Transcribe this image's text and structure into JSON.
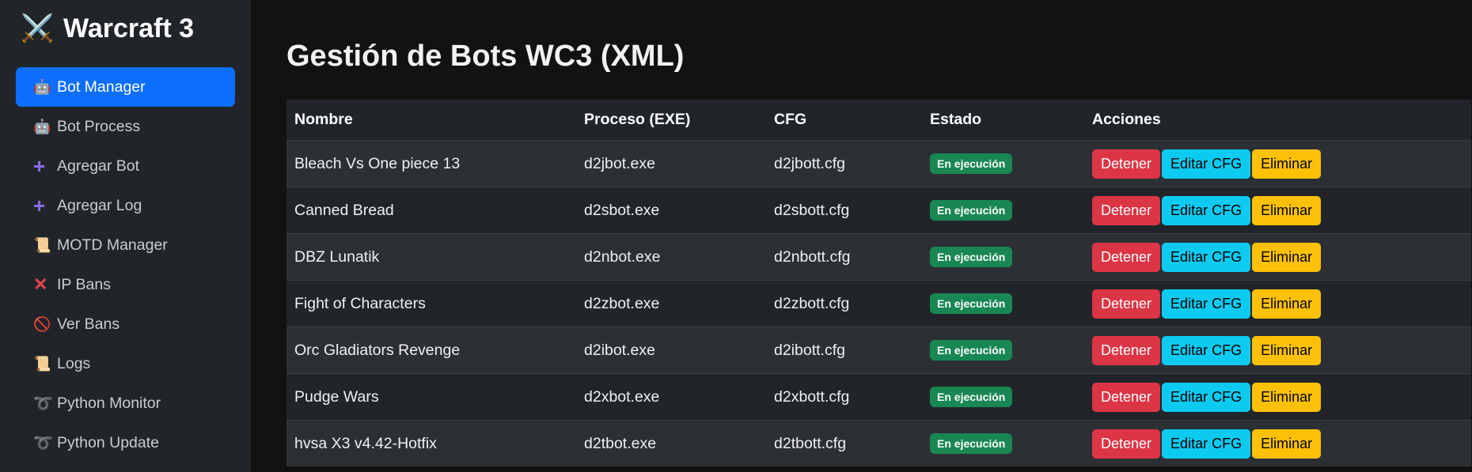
{
  "sidebar": {
    "brand_icon": "⚔️",
    "brand_title": "Warcraft 3",
    "items": [
      {
        "icon": "🤖",
        "label": "Bot Manager",
        "icon_name": "robot-icon"
      },
      {
        "icon": "🤖",
        "label": "Bot Process",
        "icon_name": "robot-icon"
      },
      {
        "icon": "+",
        "label": "Agregar Bot",
        "icon_name": "plus-icon"
      },
      {
        "icon": "+",
        "label": "Agregar Log",
        "icon_name": "plus-icon"
      },
      {
        "icon": "📜",
        "label": "MOTD Manager",
        "icon_name": "scroll-icon"
      },
      {
        "icon": "✕",
        "label": "IP Bans",
        "icon_name": "cross-icon"
      },
      {
        "icon": "🚫",
        "label": "Ver Bans",
        "icon_name": "prohibited-icon"
      },
      {
        "icon": "📜",
        "label": "Logs",
        "icon_name": "scroll-icon"
      },
      {
        "icon": "➰",
        "label": "Python Monitor",
        "icon_name": "loop-icon"
      },
      {
        "icon": "➰",
        "label": "Python Update",
        "icon_name": "loop-icon"
      }
    ]
  },
  "main": {
    "title": "Gestión de Bots WC3 (XML)",
    "table": {
      "headers": [
        "Nombre",
        "Proceso (EXE)",
        "CFG",
        "Estado",
        "Acciones"
      ],
      "rows": [
        {
          "name": "Bleach Vs One piece 13",
          "exe": "d2jbot.exe",
          "cfg": "d2jbott.cfg",
          "status": "En ejecución"
        },
        {
          "name": "Canned Bread",
          "exe": "d2sbot.exe",
          "cfg": "d2sbott.cfg",
          "status": "En ejecución"
        },
        {
          "name": "DBZ Lunatik",
          "exe": "d2nbot.exe",
          "cfg": "d2nbott.cfg",
          "status": "En ejecución"
        },
        {
          "name": "Fight of Characters",
          "exe": "d2zbot.exe",
          "cfg": "d2zbott.cfg",
          "status": "En ejecución"
        },
        {
          "name": "Orc Gladiators Revenge",
          "exe": "d2ibot.exe",
          "cfg": "d2ibott.cfg",
          "status": "En ejecución"
        },
        {
          "name": "Pudge Wars",
          "exe": "d2xbot.exe",
          "cfg": "d2xbott.cfg",
          "status": "En ejecución"
        },
        {
          "name": "hvsa X3 v4.42-Hotfix",
          "exe": "d2tbot.exe",
          "cfg": "d2tbott.cfg",
          "status": "En ejecución"
        }
      ],
      "actions": {
        "stop": "Detener",
        "edit": "Editar CFG",
        "delete": "Eliminar"
      }
    }
  },
  "colors": {
    "active": "#0d6efd",
    "danger": "#dc3545",
    "info": "#0dcaf0",
    "warning": "#ffc107",
    "success": "#198754"
  }
}
